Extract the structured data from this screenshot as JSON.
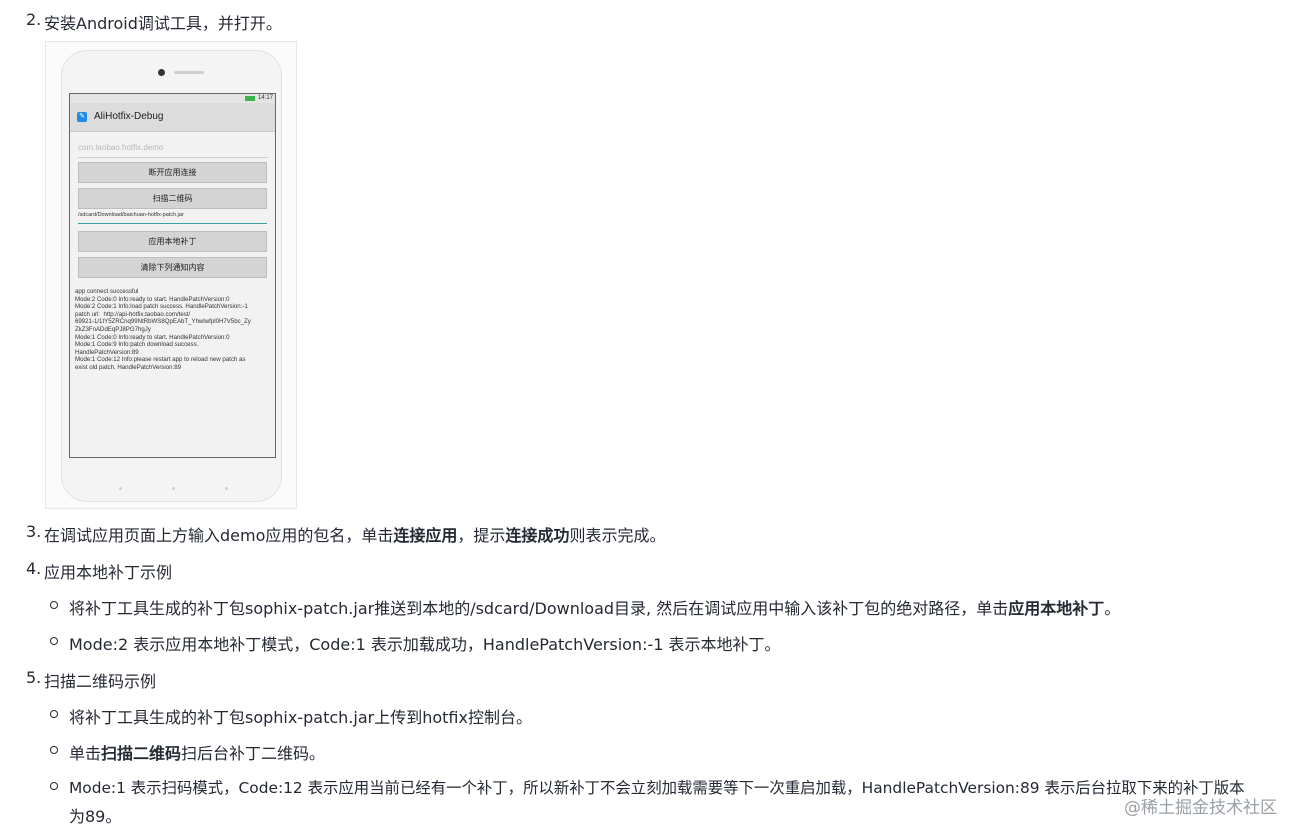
{
  "steps": {
    "s2": {
      "num": "2.",
      "text": "安装Android调试工具，并打开。"
    },
    "s3": {
      "num": "3.",
      "pre": "在调试应用页面上方输入demo应用的包名，单击",
      "b1": "连接应用",
      "mid": "，提示",
      "b2": "连接成功",
      "post": "则表示完成。"
    },
    "s4": {
      "num": "4.",
      "text": "应用本地补丁示例",
      "b1_pre": "将补丁工具生成的补丁包sophix-patch.jar推送到本地的/sdcard/Download目录, 然后在调试应用中输入该补丁包的绝对路径，单击",
      "b1_bold": "应用本地补丁",
      "b1_post": "。",
      "b2": "Mode:2 表示应用本地补丁模式，Code:1 表示加载成功，HandlePatchVersion:-1 表示本地补丁。"
    },
    "s5": {
      "num": "5.",
      "text": "扫描二维码示例",
      "b1": "将补丁工具生成的补丁包sophix-patch.jar上传到hotfix控制台。",
      "b2_pre": "单击",
      "b2_bold": "扫描二维码",
      "b2_post": "扫后台补丁二维码。",
      "b3_line1": "Mode:1 表示扫码模式，Code:12 表示应用当前已经有一个补丁，所以新补丁不会立刻加载需要等下一次重启加载，HandlePatchVersion:89 表示后台拉取下来的补丁版本",
      "b3_line2": "为89。"
    }
  },
  "phone": {
    "status_time": "14:17",
    "app_title": "AliHotfix-Debug",
    "pkg_placeholder": "com.taobao.hotfix.demo",
    "btn_disconnect": "断开应用连接",
    "btn_scan": "扫描二维码",
    "patch_path": "/sdcard/Download/baichuan-hotfix-patch.jar",
    "btn_apply": "应用本地补丁",
    "btn_clear": "清除下列通知内容",
    "log": "app connect successful\nMode:2 Code:0 Info:ready to start. HandlePatchVersion:0\nMode:2 Code:1 Info:load patch success. HandlePatchVersion:-1\npatch url:  http://api-hotfix.taobao.com/test/\n69921-1/1tY5ZRCnq99NtRbWS8QpEAbT_Yhwlwfpl0H7V5bc_Zy\nZkZ3FnADdEqPJ8PG7hgJy\nMode:1 Code:0 Info:ready to start. HandlePatchVersion:0\nMode:1 Code:9 Info:patch download success.\nHandlePatchVersion:89\nMode:1 Code:12 Info:please restart app to reload new patch as\nexist old patch. HandlePatchVersion:89"
  },
  "watermark": "@稀土掘金技术社区",
  "icons": {
    "bullet": "hollow-circle-bullet",
    "app": "wrench-icon"
  }
}
